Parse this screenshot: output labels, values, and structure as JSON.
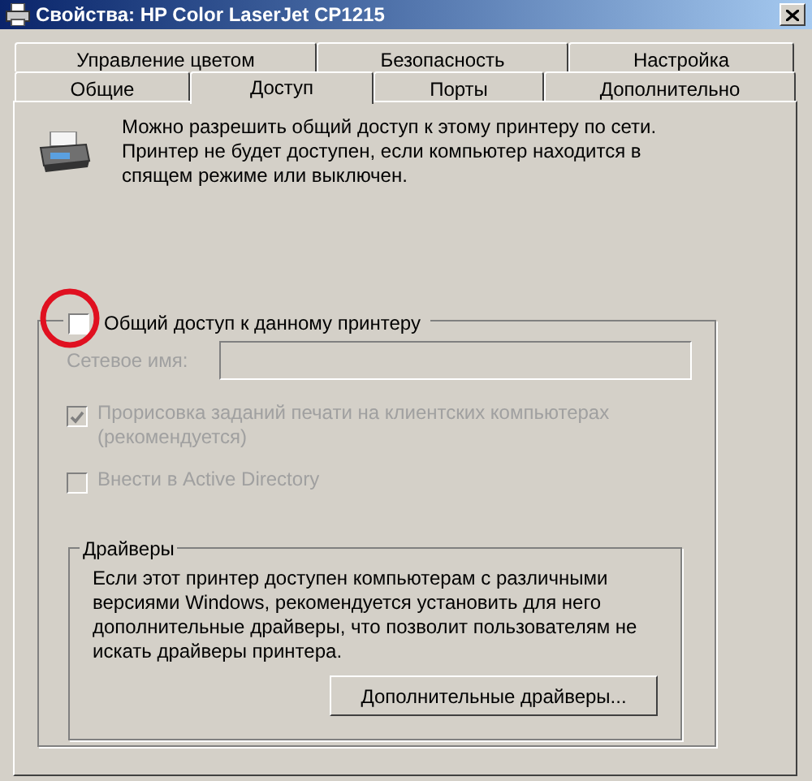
{
  "window": {
    "title": "Свойства: HP Color LaserJet CP1215"
  },
  "tab_rows": [
    {
      "tabs": [
        {
          "label": "Управление цветом",
          "selected": false
        },
        {
          "label": "Безопасность",
          "selected": false
        },
        {
          "label": "Настройка",
          "selected": false
        }
      ]
    },
    {
      "tabs": [
        {
          "label": "Общие",
          "selected": false
        },
        {
          "label": "Доступ",
          "selected": true
        },
        {
          "label": "Порты",
          "selected": false
        },
        {
          "label": "Дополнительно",
          "selected": false
        }
      ]
    }
  ],
  "description": "Можно разрешить общий доступ к этому принтеру по сети. Принтер не будет доступен, если компьютер находится в спящем режиме или выключен.",
  "share_checkbox": {
    "label": "Общий доступ к данному принтеру",
    "checked": false
  },
  "share_name": {
    "label": "Сетевое имя:",
    "disabled": true
  },
  "options": [
    {
      "label": "Прорисовка заданий печати на клиентских компьютерах (рекомендуется)",
      "checked": true,
      "disabled": true
    },
    {
      "label": "Внести в Active Directory",
      "checked": false,
      "disabled": true
    }
  ],
  "drivers": {
    "title": "Драйверы",
    "text": "Если этот принтер доступен компьютерам с различными версиями Windows, рекомендуется установить для него дополнительные драйверы, что позволит пользователям не искать драйверы принтера.",
    "button": "Дополнительные драйверы..."
  }
}
